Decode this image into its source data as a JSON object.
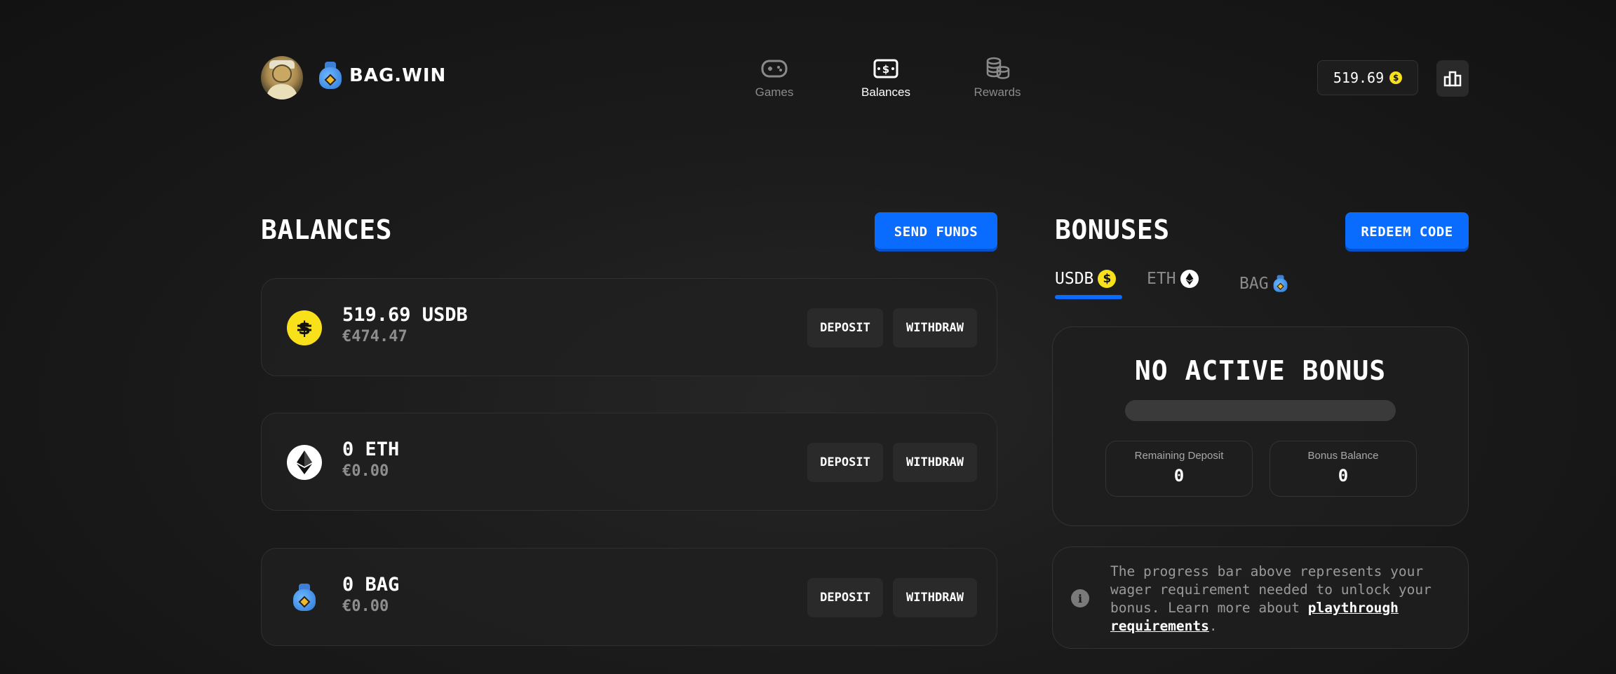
{
  "header": {
    "brand": "BAG.WIN",
    "nav": [
      {
        "label": "Games",
        "icon": "gamepad-icon",
        "active": false
      },
      {
        "label": "Balances",
        "icon": "money-icon",
        "active": true
      },
      {
        "label": "Rewards",
        "icon": "coins-icon",
        "active": false
      }
    ],
    "balance": "519.69",
    "balance_coin_symbol": "$"
  },
  "balances": {
    "title": "BALANCES",
    "send_funds": "SEND FUNDS",
    "items": [
      {
        "amount": "519.69 USDB",
        "fiat": "€474.47",
        "coin": "usdb",
        "deposit": "DEPOSIT",
        "withdraw": "WITHDRAW"
      },
      {
        "amount": "0 ETH",
        "fiat": "€0.00",
        "coin": "eth",
        "deposit": "DEPOSIT",
        "withdraw": "WITHDRAW"
      },
      {
        "amount": "0 BAG",
        "fiat": "€0.00",
        "coin": "bag",
        "deposit": "DEPOSIT",
        "withdraw": "WITHDRAW"
      }
    ]
  },
  "bonuses": {
    "title": "BONUSES",
    "redeem": "REDEEM CODE",
    "tabs": [
      {
        "label": "USDB",
        "active": true
      },
      {
        "label": "ETH",
        "active": false
      },
      {
        "label": "BAG",
        "active": false
      }
    ],
    "status": "NO ACTIVE BONUS",
    "progress": 0,
    "remaining_deposit_label": "Remaining Deposit",
    "remaining_deposit": "0",
    "bonus_balance_label": "Bonus Balance",
    "bonus_balance": "0",
    "info_prefix": "The progress bar above represents your wager requirement needed to unlock your bonus. Learn more about ",
    "info_link": "playthrough requirements",
    "info_suffix": "."
  },
  "colors": {
    "accent": "#0a6cff",
    "usdb": "#f8e11a",
    "background": "#1b1b1b"
  }
}
